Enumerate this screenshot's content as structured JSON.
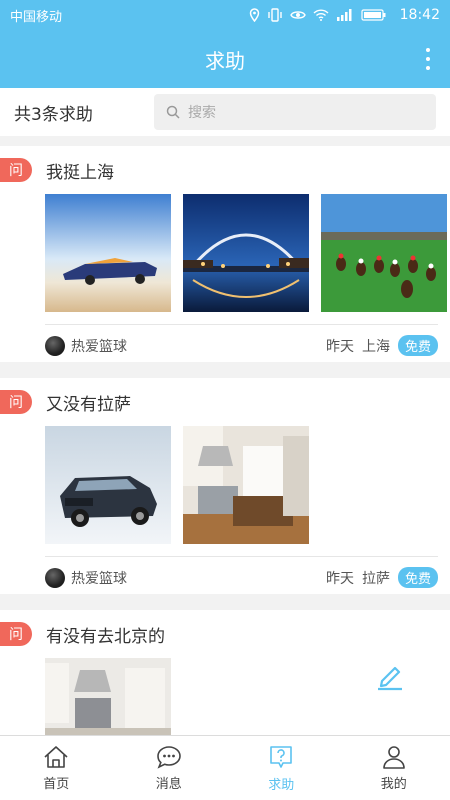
{
  "status_bar": {
    "carrier": "中国移动",
    "time": "18:42"
  },
  "header": {
    "title": "求助"
  },
  "summary": {
    "count_text": "共3条求助"
  },
  "search": {
    "placeholder": "搜索"
  },
  "question_tag": "问",
  "questions": [
    {
      "title": "我挺上海",
      "user": "热爱篮球",
      "time": "昨天",
      "city": "上海",
      "price": "免费"
    },
    {
      "title": "又没有拉萨",
      "user": "热爱篮球",
      "time": "昨天",
      "city": "拉萨",
      "price": "免费"
    },
    {
      "title": "有没有去北京的"
    }
  ],
  "tabs": [
    {
      "label": "首页",
      "icon": "home-icon"
    },
    {
      "label": "消息",
      "icon": "message-icon"
    },
    {
      "label": "求助",
      "icon": "help-icon",
      "active": true
    },
    {
      "label": "我的",
      "icon": "profile-icon"
    }
  ],
  "colors": {
    "brand": "#5bc2f0",
    "tag": "#f0685b"
  }
}
